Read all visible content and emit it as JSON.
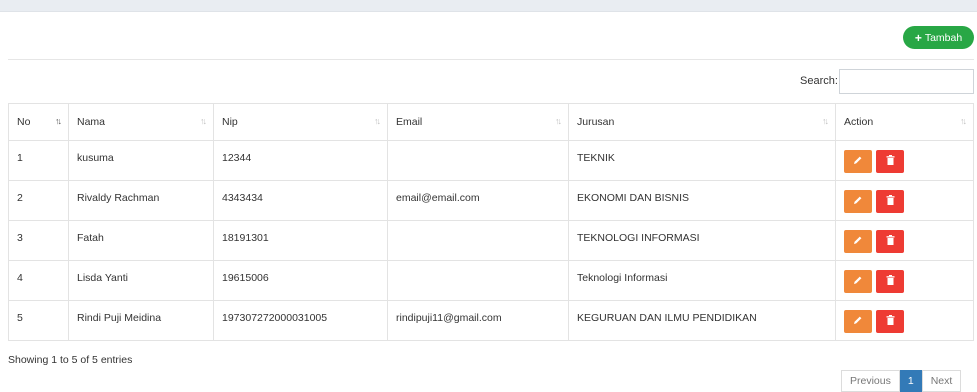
{
  "toolbar": {
    "add_label": "Tambah"
  },
  "search": {
    "label": "Search:",
    "value": ""
  },
  "table": {
    "headers": [
      "No",
      "Nama",
      "Nip",
      "Email",
      "Jurusan",
      "Action"
    ],
    "rows": [
      {
        "no": "1",
        "nama": "kusuma",
        "nip": "12344",
        "email": "",
        "jurusan": "TEKNIK"
      },
      {
        "no": "2",
        "nama": "Rivaldy Rachman",
        "nip": "4343434",
        "email": "email@email.com",
        "jurusan": "EKONOMI DAN BISNIS"
      },
      {
        "no": "3",
        "nama": "Fatah",
        "nip": "18191301",
        "email": "",
        "jurusan": "TEKNOLOGI INFORMASI"
      },
      {
        "no": "4",
        "nama": "Lisda Yanti",
        "nip": "19615006",
        "email": "",
        "jurusan": "Teknologi Informasi"
      },
      {
        "no": "5",
        "nama": "Rindi Puji Meidina",
        "nip": "197307272000031005",
        "email": "rindipuji11@gmail.com",
        "jurusan": "KEGURUAN DAN ILMU PENDIDIKAN"
      }
    ]
  },
  "footer": {
    "info": "Showing 1 to 5 of 5 entries"
  },
  "pagination": {
    "previous": "Previous",
    "current": "1",
    "next": "Next"
  },
  "colors": {
    "add": "#28a745",
    "edit": "#f0883a",
    "delete": "#ee3b33",
    "page_active": "#337ab7"
  }
}
